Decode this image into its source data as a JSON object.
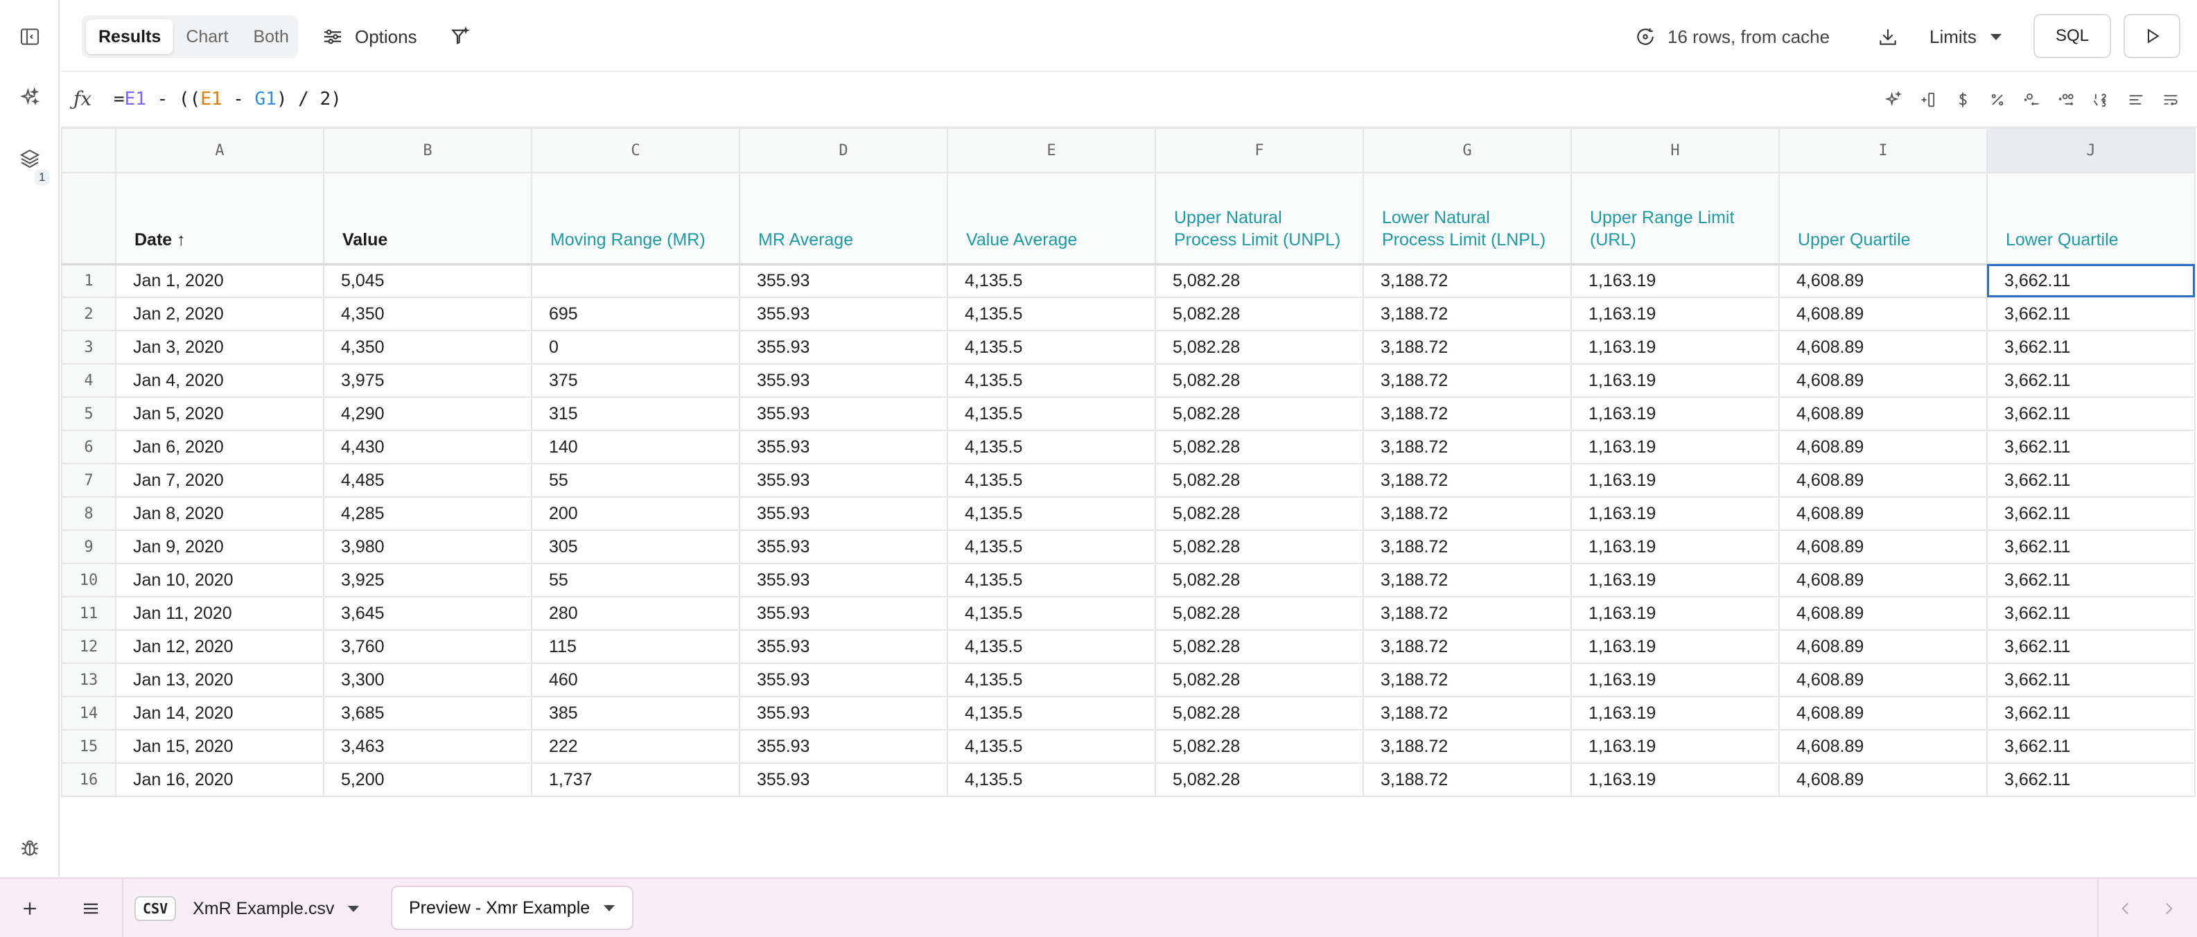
{
  "toolbar": {
    "view_tabs": [
      "Results",
      "Chart",
      "Both"
    ],
    "options_label": "Options",
    "status_text": "16 rows, from cache",
    "limits_label": "Limits",
    "sql_label": "SQL"
  },
  "formula": {
    "prefix": "=",
    "e1a": "E1",
    "mid1": " - ((",
    "e1b": "E1",
    "mid2": " - ",
    "g1": "G1",
    "tail": ") / 2)"
  },
  "rail": {
    "layers_badge": "1"
  },
  "grid": {
    "column_letters": [
      "A",
      "B",
      "C",
      "D",
      "E",
      "F",
      "G",
      "H",
      "I",
      "J"
    ],
    "headers": [
      "Date ↑",
      "Value",
      "Moving Range (MR)",
      "MR Average",
      "Value Average",
      "Upper Natural Process Limit (UNPL)",
      "Lower Natural Process Limit (LNPL)",
      "Upper Range Limit (URL)",
      "Upper Quartile",
      "Lower Quartile"
    ],
    "rows": [
      [
        "1",
        "Jan 1, 2020",
        "5,045",
        "",
        "355.93",
        "4,135.5",
        "5,082.28",
        "3,188.72",
        "1,163.19",
        "4,608.89",
        "3,662.11"
      ],
      [
        "2",
        "Jan 2, 2020",
        "4,350",
        "695",
        "355.93",
        "4,135.5",
        "5,082.28",
        "3,188.72",
        "1,163.19",
        "4,608.89",
        "3,662.11"
      ],
      [
        "3",
        "Jan 3, 2020",
        "4,350",
        "0",
        "355.93",
        "4,135.5",
        "5,082.28",
        "3,188.72",
        "1,163.19",
        "4,608.89",
        "3,662.11"
      ],
      [
        "4",
        "Jan 4, 2020",
        "3,975",
        "375",
        "355.93",
        "4,135.5",
        "5,082.28",
        "3,188.72",
        "1,163.19",
        "4,608.89",
        "3,662.11"
      ],
      [
        "5",
        "Jan 5, 2020",
        "4,290",
        "315",
        "355.93",
        "4,135.5",
        "5,082.28",
        "3,188.72",
        "1,163.19",
        "4,608.89",
        "3,662.11"
      ],
      [
        "6",
        "Jan 6, 2020",
        "4,430",
        "140",
        "355.93",
        "4,135.5",
        "5,082.28",
        "3,188.72",
        "1,163.19",
        "4,608.89",
        "3,662.11"
      ],
      [
        "7",
        "Jan 7, 2020",
        "4,485",
        "55",
        "355.93",
        "4,135.5",
        "5,082.28",
        "3,188.72",
        "1,163.19",
        "4,608.89",
        "3,662.11"
      ],
      [
        "8",
        "Jan 8, 2020",
        "4,285",
        "200",
        "355.93",
        "4,135.5",
        "5,082.28",
        "3,188.72",
        "1,163.19",
        "4,608.89",
        "3,662.11"
      ],
      [
        "9",
        "Jan 9, 2020",
        "3,980",
        "305",
        "355.93",
        "4,135.5",
        "5,082.28",
        "3,188.72",
        "1,163.19",
        "4,608.89",
        "3,662.11"
      ],
      [
        "10",
        "Jan 10, 2020",
        "3,925",
        "55",
        "355.93",
        "4,135.5",
        "5,082.28",
        "3,188.72",
        "1,163.19",
        "4,608.89",
        "3,662.11"
      ],
      [
        "11",
        "Jan 11, 2020",
        "3,645",
        "280",
        "355.93",
        "4,135.5",
        "5,082.28",
        "3,188.72",
        "1,163.19",
        "4,608.89",
        "3,662.11"
      ],
      [
        "12",
        "Jan 12, 2020",
        "3,760",
        "115",
        "355.93",
        "4,135.5",
        "5,082.28",
        "3,188.72",
        "1,163.19",
        "4,608.89",
        "3,662.11"
      ],
      [
        "13",
        "Jan 13, 2020",
        "3,300",
        "460",
        "355.93",
        "4,135.5",
        "5,082.28",
        "3,188.72",
        "1,163.19",
        "4,608.89",
        "3,662.11"
      ],
      [
        "14",
        "Jan 14, 2020",
        "3,685",
        "385",
        "355.93",
        "4,135.5",
        "5,082.28",
        "3,188.72",
        "1,163.19",
        "4,608.89",
        "3,662.11"
      ],
      [
        "15",
        "Jan 15, 2020",
        "3,463",
        "222",
        "355.93",
        "4,135.5",
        "5,082.28",
        "3,188.72",
        "1,163.19",
        "4,608.89",
        "3,662.11"
      ],
      [
        "16",
        "Jan 16, 2020",
        "5,200",
        "1,737",
        "355.93",
        "4,135.5",
        "5,082.28",
        "3,188.72",
        "1,163.19",
        "4,608.89",
        "3,662.11"
      ]
    ]
  },
  "bottom": {
    "csv_tag": "CSV",
    "file_tab": "XmR Example.csv",
    "preview_tab": "Preview - Xmr Example"
  },
  "colors": {
    "accent_teal": "#1b9aa7",
    "selection_blue": "#2f6fc4",
    "bottom_bg": "#f9eef6"
  }
}
